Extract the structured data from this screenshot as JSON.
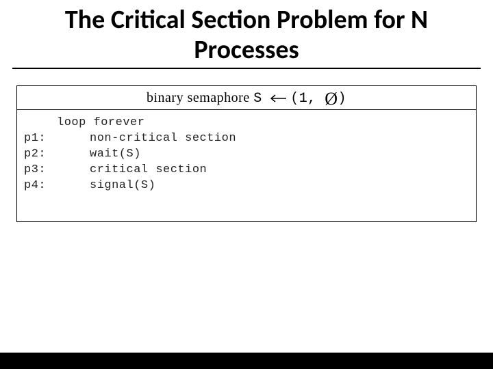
{
  "title": "The Critical Section Problem for N Processes",
  "declaration": {
    "prefix_serif": "binary semaphore ",
    "var": "S",
    "init_open": "(1, ",
    "empty_set": "Ø",
    "init_close": ")"
  },
  "code": {
    "loop_label": "loop forever",
    "lines": [
      {
        "label": "p1:",
        "text": "non-critical section"
      },
      {
        "label": "p2:",
        "text": "wait(S)"
      },
      {
        "label": "p3:",
        "text": "critical section"
      },
      {
        "label": "p4:",
        "text": "signal(S)"
      }
    ]
  }
}
